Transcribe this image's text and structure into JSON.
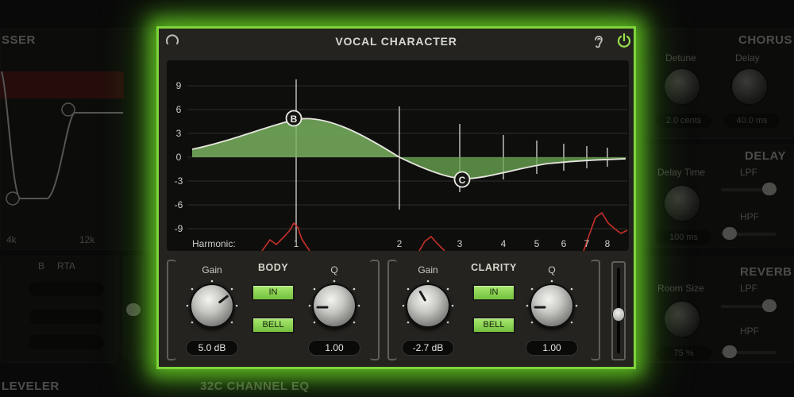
{
  "background": {
    "left_panel": {
      "title": "SSER",
      "labels": [
        "4k",
        "12k"
      ],
      "rta_label": "RTA",
      "rta_led": "B"
    },
    "left_bottom": {
      "title": "LEVELER"
    },
    "right_top": {
      "title": "CHORUS",
      "detune_label": "Detune",
      "detune_value": "2.0 cents",
      "delay_label": "Delay",
      "delay_value": "40.0 ms"
    },
    "right_mid": {
      "title": "DELAY",
      "delay_time_label": "Delay Time",
      "delay_time_value": "100 ms",
      "lpf_label": "LPF",
      "hpf_label": "HPF"
    },
    "right_bottom": {
      "title": "REVERB",
      "room_size_label": "Room Size",
      "room_size_value": "75 %",
      "lpf_label": "LPF",
      "hpf_label": "HPF"
    },
    "bottom_center": {
      "title": "32C CHANNEL EQ"
    }
  },
  "plugin": {
    "title": "VOCAL CHARACTER",
    "accent_color": "#7ed43a",
    "icons": {
      "reset": "reset-icon",
      "listen": "ear-icon",
      "power": "power-icon"
    },
    "eq_display": {
      "y_axis_labels": [
        "9",
        "6",
        "3",
        "0",
        "-3",
        "-6",
        "-9"
      ],
      "harmonic_label": "Harmonic:",
      "harmonic_numbers": [
        "1",
        "2",
        "3",
        "4",
        "5",
        "6",
        "7",
        "8"
      ],
      "node_b_label": "B",
      "node_c_label": "C"
    },
    "body": {
      "title": "BODY",
      "gain_label": "Gain",
      "gain_value": "5.0 dB",
      "q_label": "Q",
      "q_value": "1.00",
      "in_button": "IN",
      "shape_button": "BELL"
    },
    "clarity": {
      "title": "CLARITY",
      "gain_label": "Gain",
      "gain_value": "-2.7 dB",
      "q_label": "Q",
      "q_value": "1.00",
      "in_button": "IN",
      "shape_button": "BELL"
    },
    "output_fader_level": 0.45
  }
}
